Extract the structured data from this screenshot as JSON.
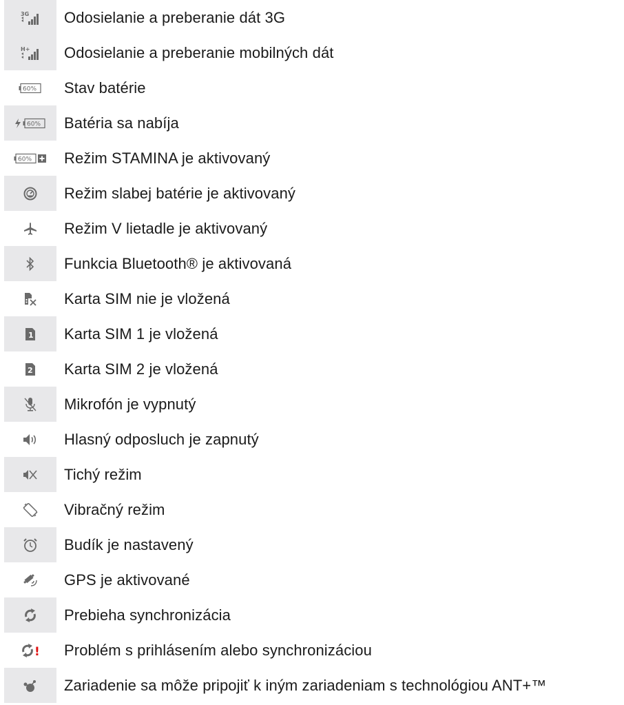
{
  "icons_table": {
    "rows": [
      {
        "icon": "3g-data-icon",
        "label": "Odosielanie a preberanie dát 3G",
        "icon_text": "3G"
      },
      {
        "icon": "mobile-data-icon",
        "label": "Odosielanie a preberanie mobilných dát",
        "icon_text": "H+"
      },
      {
        "icon": "battery-icon",
        "label": "Stav batérie",
        "icon_text": "60%"
      },
      {
        "icon": "battery-charging-icon",
        "label": "Batéria sa nabíja",
        "icon_text": "60%"
      },
      {
        "icon": "stamina-battery-icon",
        "label": "Režim STAMINA je aktivovaný",
        "icon_text": "60%"
      },
      {
        "icon": "low-battery-mode-icon",
        "label": "Režim slabej batérie je aktivovaný"
      },
      {
        "icon": "airplane-icon",
        "label": "Režim V lietadle je aktivovaný"
      },
      {
        "icon": "bluetooth-icon",
        "label": "Funkcia Bluetooth® je aktivovaná"
      },
      {
        "icon": "no-sim-icon",
        "label": "Karta SIM nie je vložená"
      },
      {
        "icon": "sim-1-icon",
        "label": "Karta SIM 1 je vložená",
        "icon_text": "1"
      },
      {
        "icon": "sim-2-icon",
        "label": "Karta SIM 2 je vložená",
        "icon_text": "2"
      },
      {
        "icon": "microphone-muted-icon",
        "label": "Mikrofón je vypnutý"
      },
      {
        "icon": "speakerphone-icon",
        "label": "Hlasný odposluch je zapnutý"
      },
      {
        "icon": "silent-mode-icon",
        "label": "Tichý režim"
      },
      {
        "icon": "vibrate-mode-icon",
        "label": "Vibračný režim"
      },
      {
        "icon": "alarm-icon",
        "label": "Budík je nastavený"
      },
      {
        "icon": "gps-icon",
        "label": "GPS je aktivované"
      },
      {
        "icon": "sync-icon",
        "label": "Prebieha synchronizácia"
      },
      {
        "icon": "sync-problem-icon",
        "label": "Problém s prihlásením alebo synchronizáciou",
        "icon_text": "!"
      },
      {
        "icon": "ant-plus-icon",
        "label": "Zariadenie sa môže pripojiť k iným zariadeniam s technológiou ANT+™"
      }
    ]
  },
  "colors": {
    "icon_cell_shade": "#e8e8ea",
    "icon_gray": "#6a6a6a",
    "label_text": "#1b1b1b",
    "warning_red": "#e01010"
  }
}
